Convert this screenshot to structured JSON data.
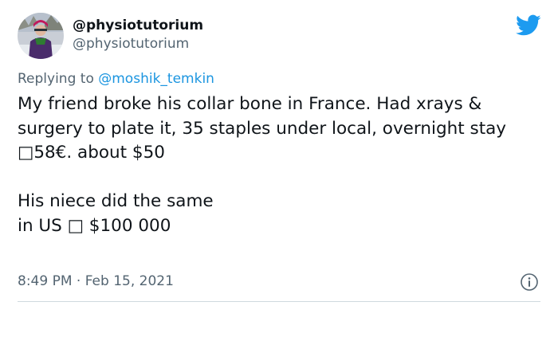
{
  "author": {
    "display_name": "@physiotutorium",
    "handle": "@physiotutorium",
    "avatar_icon": "profile-photo-person-in-snow"
  },
  "brand": {
    "icon": "twitter-bird-icon",
    "color": "#1d9bf0"
  },
  "reply": {
    "prefix": "Replying to ",
    "mention": "@moshik_temkin",
    "mention_color": "#1b95e0"
  },
  "tweet": {
    "text": "My friend broke his collar bone in France. Had xrays & surgery to plate it, 35 staples under local, overnight stay\n□58€. about $50\n\nHis niece did the same\nin US □ $100 000",
    "timestamp": "8:49 PM · Feb 15, 2021"
  },
  "actions": {
    "info_icon": "info-icon"
  }
}
